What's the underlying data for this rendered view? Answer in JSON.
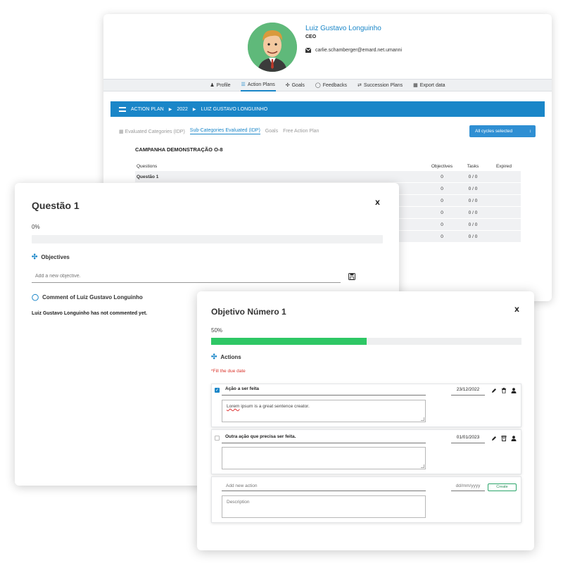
{
  "profile": {
    "name": "Luiz Gustavo Longuinho",
    "role": "CEO",
    "email": "carlie.schamberger@emard.net.umanni"
  },
  "nav": {
    "items": [
      {
        "label": "Profile",
        "icon": "person-icon"
      },
      {
        "label": "Action Plans",
        "icon": "list-icon",
        "active": true
      },
      {
        "label": "Goals",
        "icon": "target-icon"
      },
      {
        "label": "Feedbacks",
        "icon": "chat-icon"
      },
      {
        "label": "Succession Plans",
        "icon": "swap-icon"
      },
      {
        "label": "Export data",
        "icon": "file-icon"
      }
    ]
  },
  "breadcrumb": {
    "items": [
      "ACTION PLAN",
      "2022",
      "LUIZ GUSTAVO LONGUINHO"
    ]
  },
  "subtabs": {
    "items": [
      "Evaluated Categories (IDP)",
      "Sub-Categories Evaluated (IDP)",
      "Goals",
      "Free Action Plan"
    ],
    "active_index": 1
  },
  "cycles": {
    "label": "All cycles selected"
  },
  "campaign": {
    "title": "CAMPANHA DEMONSTRAÇÃO O-8"
  },
  "questions_table": {
    "headers": [
      "Questions",
      "Objectives",
      "Tasks",
      "Expired"
    ],
    "rows": [
      {
        "question": "Questão 1",
        "objectives": "0",
        "tasks": "0 / 0",
        "expired": ""
      },
      {
        "question": "",
        "objectives": "0",
        "tasks": "0 / 0",
        "expired": ""
      },
      {
        "question": "",
        "objectives": "0",
        "tasks": "0 / 0",
        "expired": ""
      },
      {
        "question": "",
        "objectives": "0",
        "tasks": "0 / 0",
        "expired": ""
      },
      {
        "question": "",
        "objectives": "0",
        "tasks": "0 / 0",
        "expired": ""
      },
      {
        "question": "",
        "objectives": "0",
        "tasks": "0 / 0",
        "expired": ""
      }
    ]
  },
  "question_modal": {
    "title": "Questão 1",
    "close": "X",
    "progress_label": "0%",
    "progress": 0,
    "objectives_label": "Objectives",
    "new_objective_placeholder": "Add a new objective.",
    "comment_label": "Comment of Luiz Gustavo Longuinho",
    "no_comment": "Luiz Gustavo Longuinho has not commented yet."
  },
  "objective_modal": {
    "title": "Objetivo Número 1",
    "close": "X",
    "progress_label": "50%",
    "progress": 0.5,
    "actions_label": "Actions",
    "warning": "*Fill the due date",
    "actions": [
      {
        "title": "Ação a ser feita",
        "description_first": "Lorem",
        "description_rest": " ipsum is a great sentence creator.",
        "date": "23/12/2022",
        "checked": true
      },
      {
        "title": "Outra ação que precisa ser feita.",
        "description_first": "",
        "description_rest": "",
        "date": "01/01/2023",
        "checked": false
      }
    ],
    "new_action": {
      "title_placeholder": "Add new action",
      "description_placeholder": "Description",
      "date_placeholder": "dd/mm/yyyy",
      "create_label": "Create"
    }
  },
  "colors": {
    "accent": "#1a86c8",
    "progress_fill": "#2ec765",
    "warning": "#d9342b"
  }
}
